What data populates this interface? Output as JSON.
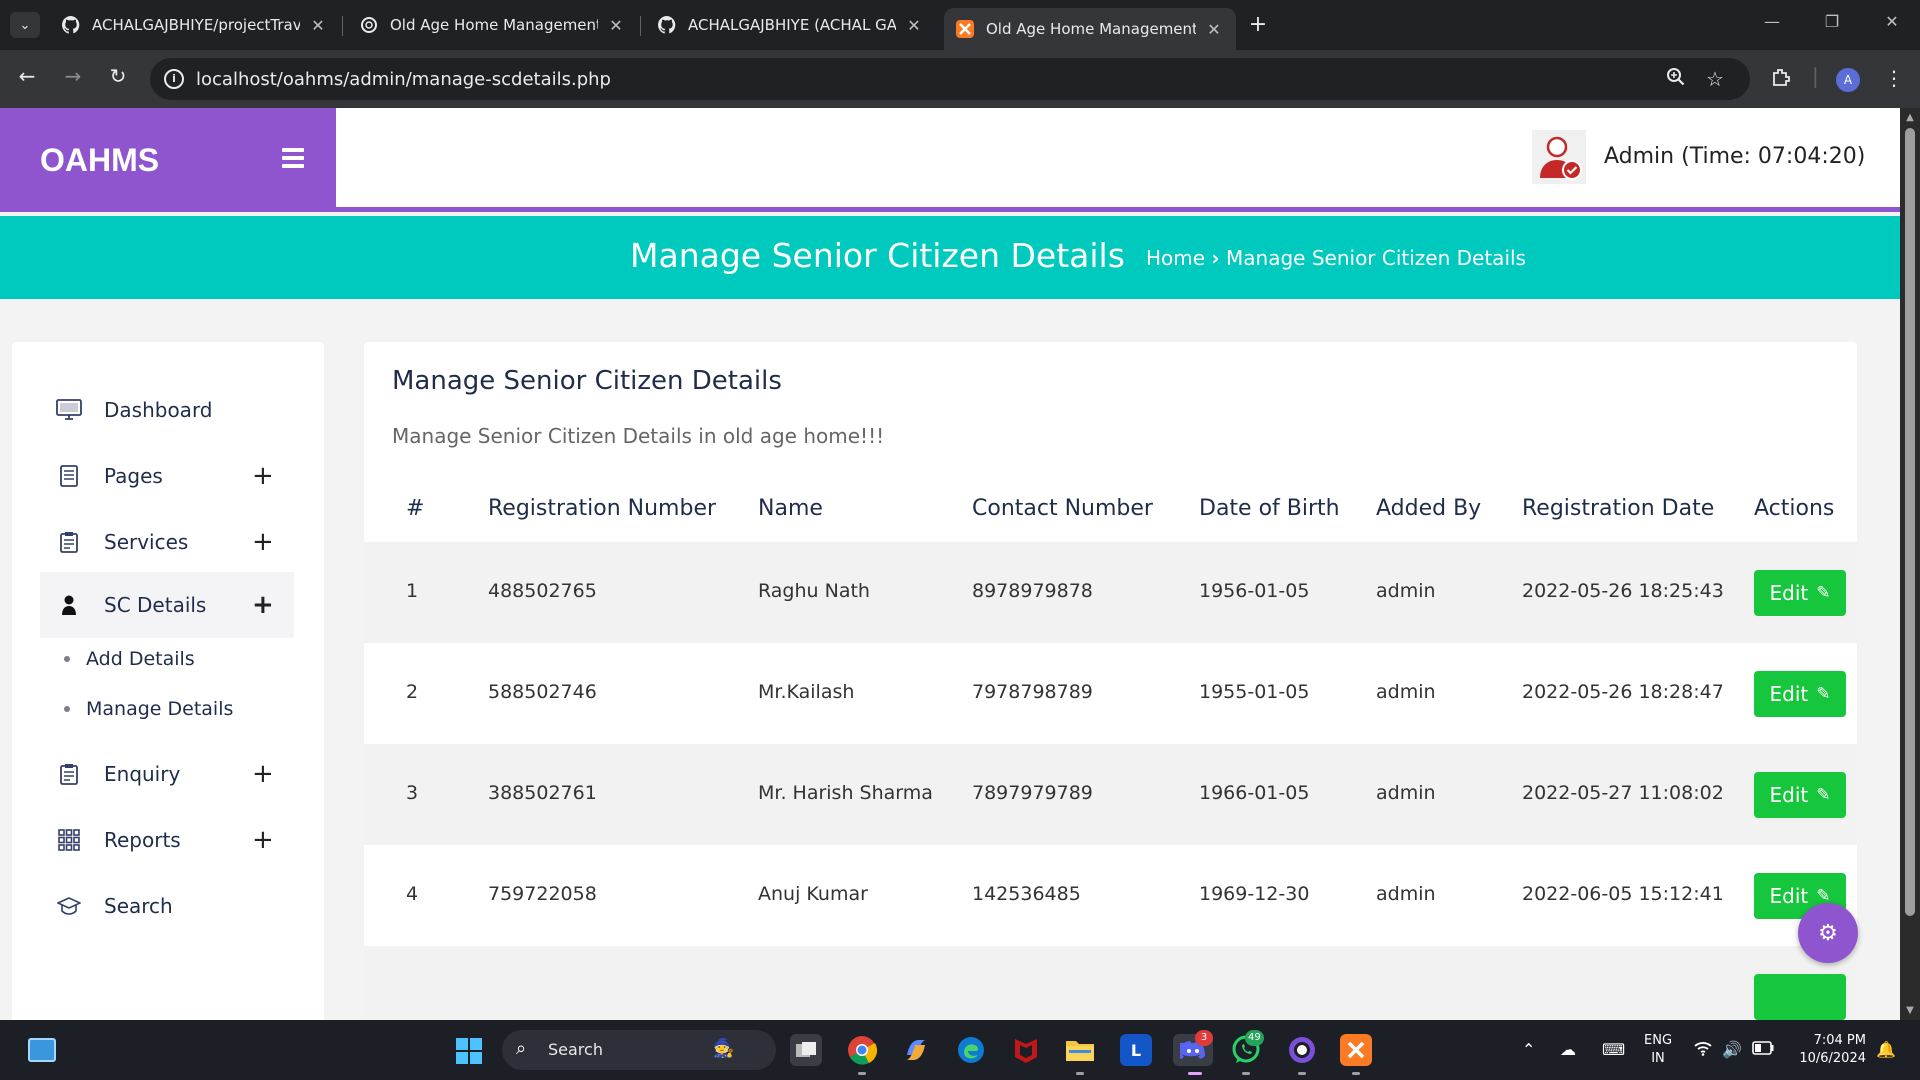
{
  "browser": {
    "tabs": [
      {
        "title": "ACHALGAJBHIYE/projectTravelling",
        "icon": "github-icon",
        "active": false
      },
      {
        "title": "Old Age Home Management",
        "icon": "openai-icon",
        "active": false
      },
      {
        "title": "ACHALGAJBHIYE (ACHAL GAJBHIYE)",
        "icon": "github-icon",
        "active": false
      },
      {
        "title": "Old Age Home Management System",
        "icon": "xampp-icon",
        "active": true
      }
    ],
    "url": "localhost/oahms/admin/manage-scdetails.php",
    "profile_initial": "A"
  },
  "app": {
    "brand": "OAHMS",
    "admin_label": "Admin (Time: 07:04:20)",
    "hero_title": "Manage Senior Citizen Details",
    "breadcrumb": {
      "home": "Home",
      "sep": "›",
      "current": "Manage Senior Citizen Details"
    },
    "accent": "#8f55cf",
    "hero_color": "#00c9bd",
    "button_color": "#16c63c"
  },
  "sidebar": {
    "items": [
      {
        "label": "Dashboard",
        "icon": "monitor-icon",
        "expandable": false
      },
      {
        "label": "Pages",
        "icon": "document-icon",
        "expandable": true
      },
      {
        "label": "Services",
        "icon": "clipboard-icon",
        "expandable": true
      },
      {
        "label": "SC Details",
        "icon": "person-icon",
        "expandable": true,
        "active": true
      },
      {
        "label": "Enquiry",
        "icon": "clipboard-icon",
        "expandable": true
      },
      {
        "label": "Reports",
        "icon": "grid-icon",
        "expandable": true
      },
      {
        "label": "Search",
        "icon": "graduation-cap-icon",
        "expandable": false
      }
    ],
    "subitems": [
      "Add Details",
      "Manage Details"
    ],
    "plus": "+"
  },
  "main": {
    "title": "Manage Senior Citizen Details",
    "subtitle": "Manage Senior Citizen Details in old age home!!!",
    "columns": [
      "#",
      "Registration Number",
      "Name",
      "Contact Number",
      "Date of Birth",
      "Added By",
      "Registration Date",
      "Actions"
    ],
    "rows": [
      {
        "num": "1",
        "reg": "488502765",
        "name": "Raghu Nath",
        "contact": "8978979878",
        "dob": "1956-01-05",
        "added_by": "admin",
        "reg_date": "2022-05-26 18:25:43"
      },
      {
        "num": "2",
        "reg": "588502746",
        "name": "Mr.Kailash",
        "contact": "7978798789",
        "dob": "1955-01-05",
        "added_by": "admin",
        "reg_date": "2022-05-26 18:28:47"
      },
      {
        "num": "3",
        "reg": "388502761",
        "name": "Mr. Harish Sharma",
        "contact": "7897979789",
        "dob": "1966-01-05",
        "added_by": "admin",
        "reg_date": "2022-05-27 11:08:02"
      },
      {
        "num": "4",
        "reg": "759722058",
        "name": "Anuj Kumar",
        "contact": "142536485",
        "dob": "1969-12-30",
        "added_by": "admin",
        "reg_date": "2022-06-05 15:12:41"
      }
    ],
    "edit_label": "Edit"
  },
  "taskbar": {
    "search_label": "Search",
    "apps": [
      "chrome-icon",
      "copilot-icon",
      "edge-icon",
      "mcafee-icon",
      "file-explorer-icon",
      "l-app-icon",
      "discord-icon",
      "whatsapp-icon",
      "github-desktop-icon",
      "xampp-icon"
    ],
    "discord_badge": "3",
    "whatsapp_badge": "49",
    "lang_top": "ENG",
    "lang_bottom": "IN",
    "time": "7:04 PM",
    "date": "10/6/2024"
  }
}
